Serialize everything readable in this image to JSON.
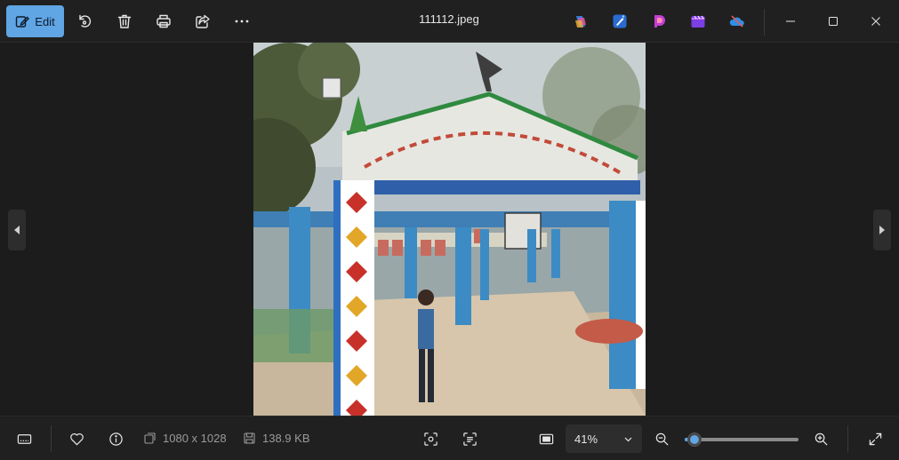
{
  "toolbar": {
    "edit_label": "Edit",
    "title": "111112.jpeg",
    "icons": [
      "rotate-icon",
      "delete-icon",
      "print-icon",
      "share-icon",
      "more-icon"
    ]
  },
  "apps": [
    "copilot-icon",
    "designer-icon",
    "clipchamp-icon",
    "video-editor-icon",
    "onedrive-icon"
  ],
  "colors": {
    "accent": "#60a5e4",
    "background": "#1c1c1c",
    "toolbar": "#202020"
  },
  "footer": {
    "dimensions": "1080 x 1028",
    "filesize": "138.9 KB",
    "zoom": "41%",
    "zoom_percent": 41
  }
}
